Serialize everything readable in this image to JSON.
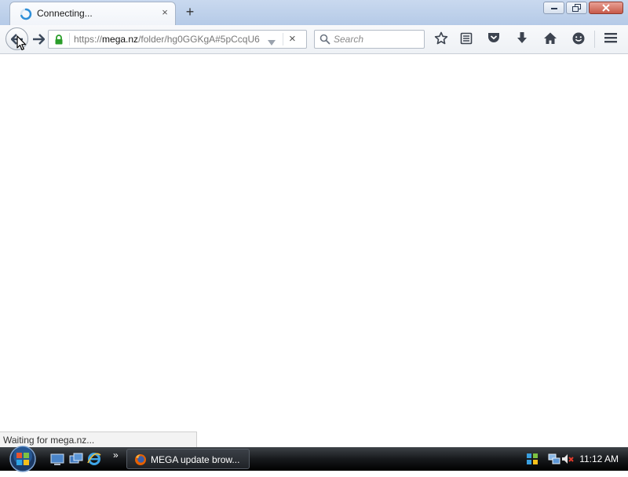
{
  "tab": {
    "title": "Connecting...",
    "close_label": "×"
  },
  "new_tab_label": "+",
  "url": {
    "scheme": "https://",
    "host": "mega.nz",
    "path": "/folder/hg0GGKgA#5pCcqU6"
  },
  "search": {
    "placeholder": "Search"
  },
  "stop_label": "×",
  "status_text": "Waiting for mega.nz...",
  "taskbar": {
    "task_label": "MEGA update brow...",
    "quicklaunch_more": "»",
    "clock": "11:12 AM"
  },
  "colors": {
    "accent_spinner": "#2f8fd8",
    "secure_lock": "#2a9d2a",
    "close_button": "#c75a4a"
  },
  "icons": {
    "toolbar": [
      "bookmark-star-icon",
      "reading-list-icon",
      "pocket-icon",
      "download-icon",
      "home-icon",
      "hello-icon",
      "menu-icon"
    ],
    "tray": [
      "network-icon",
      "volume-muted-icon"
    ]
  }
}
